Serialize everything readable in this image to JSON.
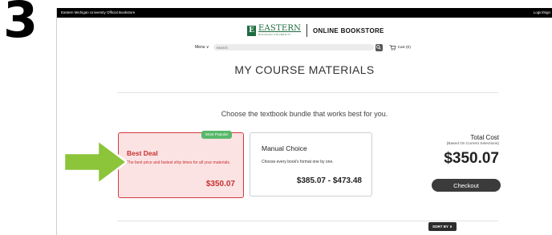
{
  "step_number": "3",
  "topbar": {
    "store_name": "Eastern Michigan University Official Bookstore",
    "login_text": "Login/Sign"
  },
  "header": {
    "logo_letter": "E",
    "logo_brand": "EASTERN",
    "logo_subtitle": "MICHIGAN UNIVERSITY",
    "store_title": "ONLINE BOOKSTORE"
  },
  "nav": {
    "menu_label": "Menu ∨",
    "search_placeholder": "Search",
    "cart_label": "Cart (0)"
  },
  "page": {
    "title": "MY COURSE MATERIALS",
    "subtitle": "Choose the textbook bundle that works best for you."
  },
  "bundles": [
    {
      "badge": "Most Popular",
      "title": "Best Deal",
      "description": "The best price and fastest ship times for all your materials.",
      "price": "$350.07"
    },
    {
      "title": "Manual Choice",
      "description": "Choose every book's format one by one.",
      "price": "$385.07 - $473.48"
    }
  ],
  "summary": {
    "label": "Total Cost",
    "sublabel": "(Based On Current Selections)",
    "amount": "$350.07",
    "checkout_label": "Checkout"
  },
  "sort": {
    "label": "SORT BY ∨"
  },
  "colors": {
    "brand_green": "#1d6b3f",
    "best_deal_red": "#c73030",
    "badge_green": "#58b86a",
    "arrow_green": "#8cc43a"
  },
  "icons": {
    "search": "magnifier",
    "cart": "shopping-cart",
    "annotation": "right-arrow"
  }
}
